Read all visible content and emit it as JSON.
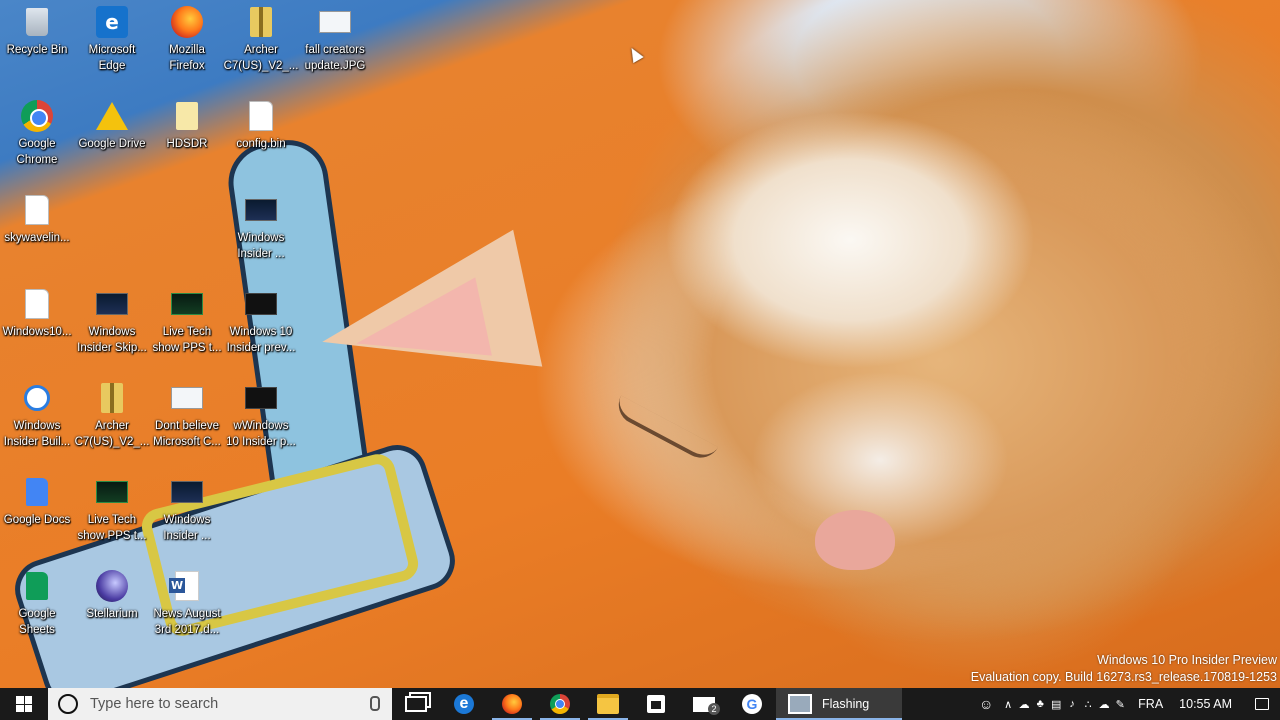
{
  "desktop": {
    "icons": [
      {
        "label": "Recycle Bin",
        "icon": "recycle-bin-icon"
      },
      {
        "label": "Microsoft\nEdge",
        "icon": "edge-icon"
      },
      {
        "label": "Mozilla\nFirefox",
        "icon": "firefox-icon"
      },
      {
        "label": "Archer\nC7(US)_V2_...",
        "icon": "archive-icon"
      },
      {
        "label": "fall creators\nupdate.JPG",
        "icon": "image-file-icon"
      },
      {
        "label": "Google\nChrome",
        "icon": "chrome-icon"
      },
      {
        "label": "Google Drive",
        "icon": "google-drive-icon"
      },
      {
        "label": "HDSDR",
        "icon": "folder-file-icon"
      },
      {
        "label": "config.bin",
        "icon": "file-icon"
      },
      {
        "label": "skywavelin...",
        "icon": "file-icon"
      },
      {
        "label": "Windows\nInsider ...",
        "icon": "screenshot-file-icon"
      },
      {
        "label": "Windows10...",
        "icon": "file-icon"
      },
      {
        "label": "Windows\nInsider Skip...",
        "icon": "screenshot-file-icon"
      },
      {
        "label": "Live Tech\nshow PPS t...",
        "icon": "video-file-icon"
      },
      {
        "label": "Windows 10\nInsider prev...",
        "icon": "video-file-icon"
      },
      {
        "label": "Windows\nInsider Buil...",
        "icon": "settings-file-icon"
      },
      {
        "label": "Archer\nC7(US)_V2_...",
        "icon": "archive-icon"
      },
      {
        "label": "Dont believe\nMicrosoft C...",
        "icon": "image-file-icon"
      },
      {
        "label": "wWindows\n10 Insider p...",
        "icon": "video-file-icon"
      },
      {
        "label": "Google Docs",
        "icon": "google-docs-icon"
      },
      {
        "label": "Live Tech\nshow PPS t...",
        "icon": "video-file-icon"
      },
      {
        "label": "Windows\nInsider ...",
        "icon": "screenshot-file-icon"
      },
      {
        "label": "Google\nSheets",
        "icon": "google-sheets-icon"
      },
      {
        "label": "Stellarium",
        "icon": "stellarium-icon"
      },
      {
        "label": "News August\n3rd 2017.d...",
        "icon": "word-document-icon"
      }
    ],
    "watermark": {
      "line1": "Windows 10 Pro Insider Preview",
      "line2": "Evaluation copy. Build 16273.rs3_release.170819-1253"
    }
  },
  "taskbar": {
    "search_placeholder": "Type here to search",
    "pinned": [
      {
        "name": "task-view",
        "icon": "task-view-icon"
      },
      {
        "name": "edge",
        "icon": "edge-icon"
      },
      {
        "name": "firefox",
        "icon": "firefox-icon"
      },
      {
        "name": "chrome",
        "icon": "chrome-icon"
      },
      {
        "name": "file-explorer",
        "icon": "folder-icon"
      },
      {
        "name": "store",
        "icon": "store-icon"
      },
      {
        "name": "mail",
        "icon": "mail-icon",
        "badge": "2"
      },
      {
        "name": "google",
        "icon": "google-icon"
      }
    ],
    "active_app_label": "Flashing",
    "mail_badge": "2",
    "tray": {
      "language": "FRA",
      "time": "10:55 AM"
    }
  }
}
